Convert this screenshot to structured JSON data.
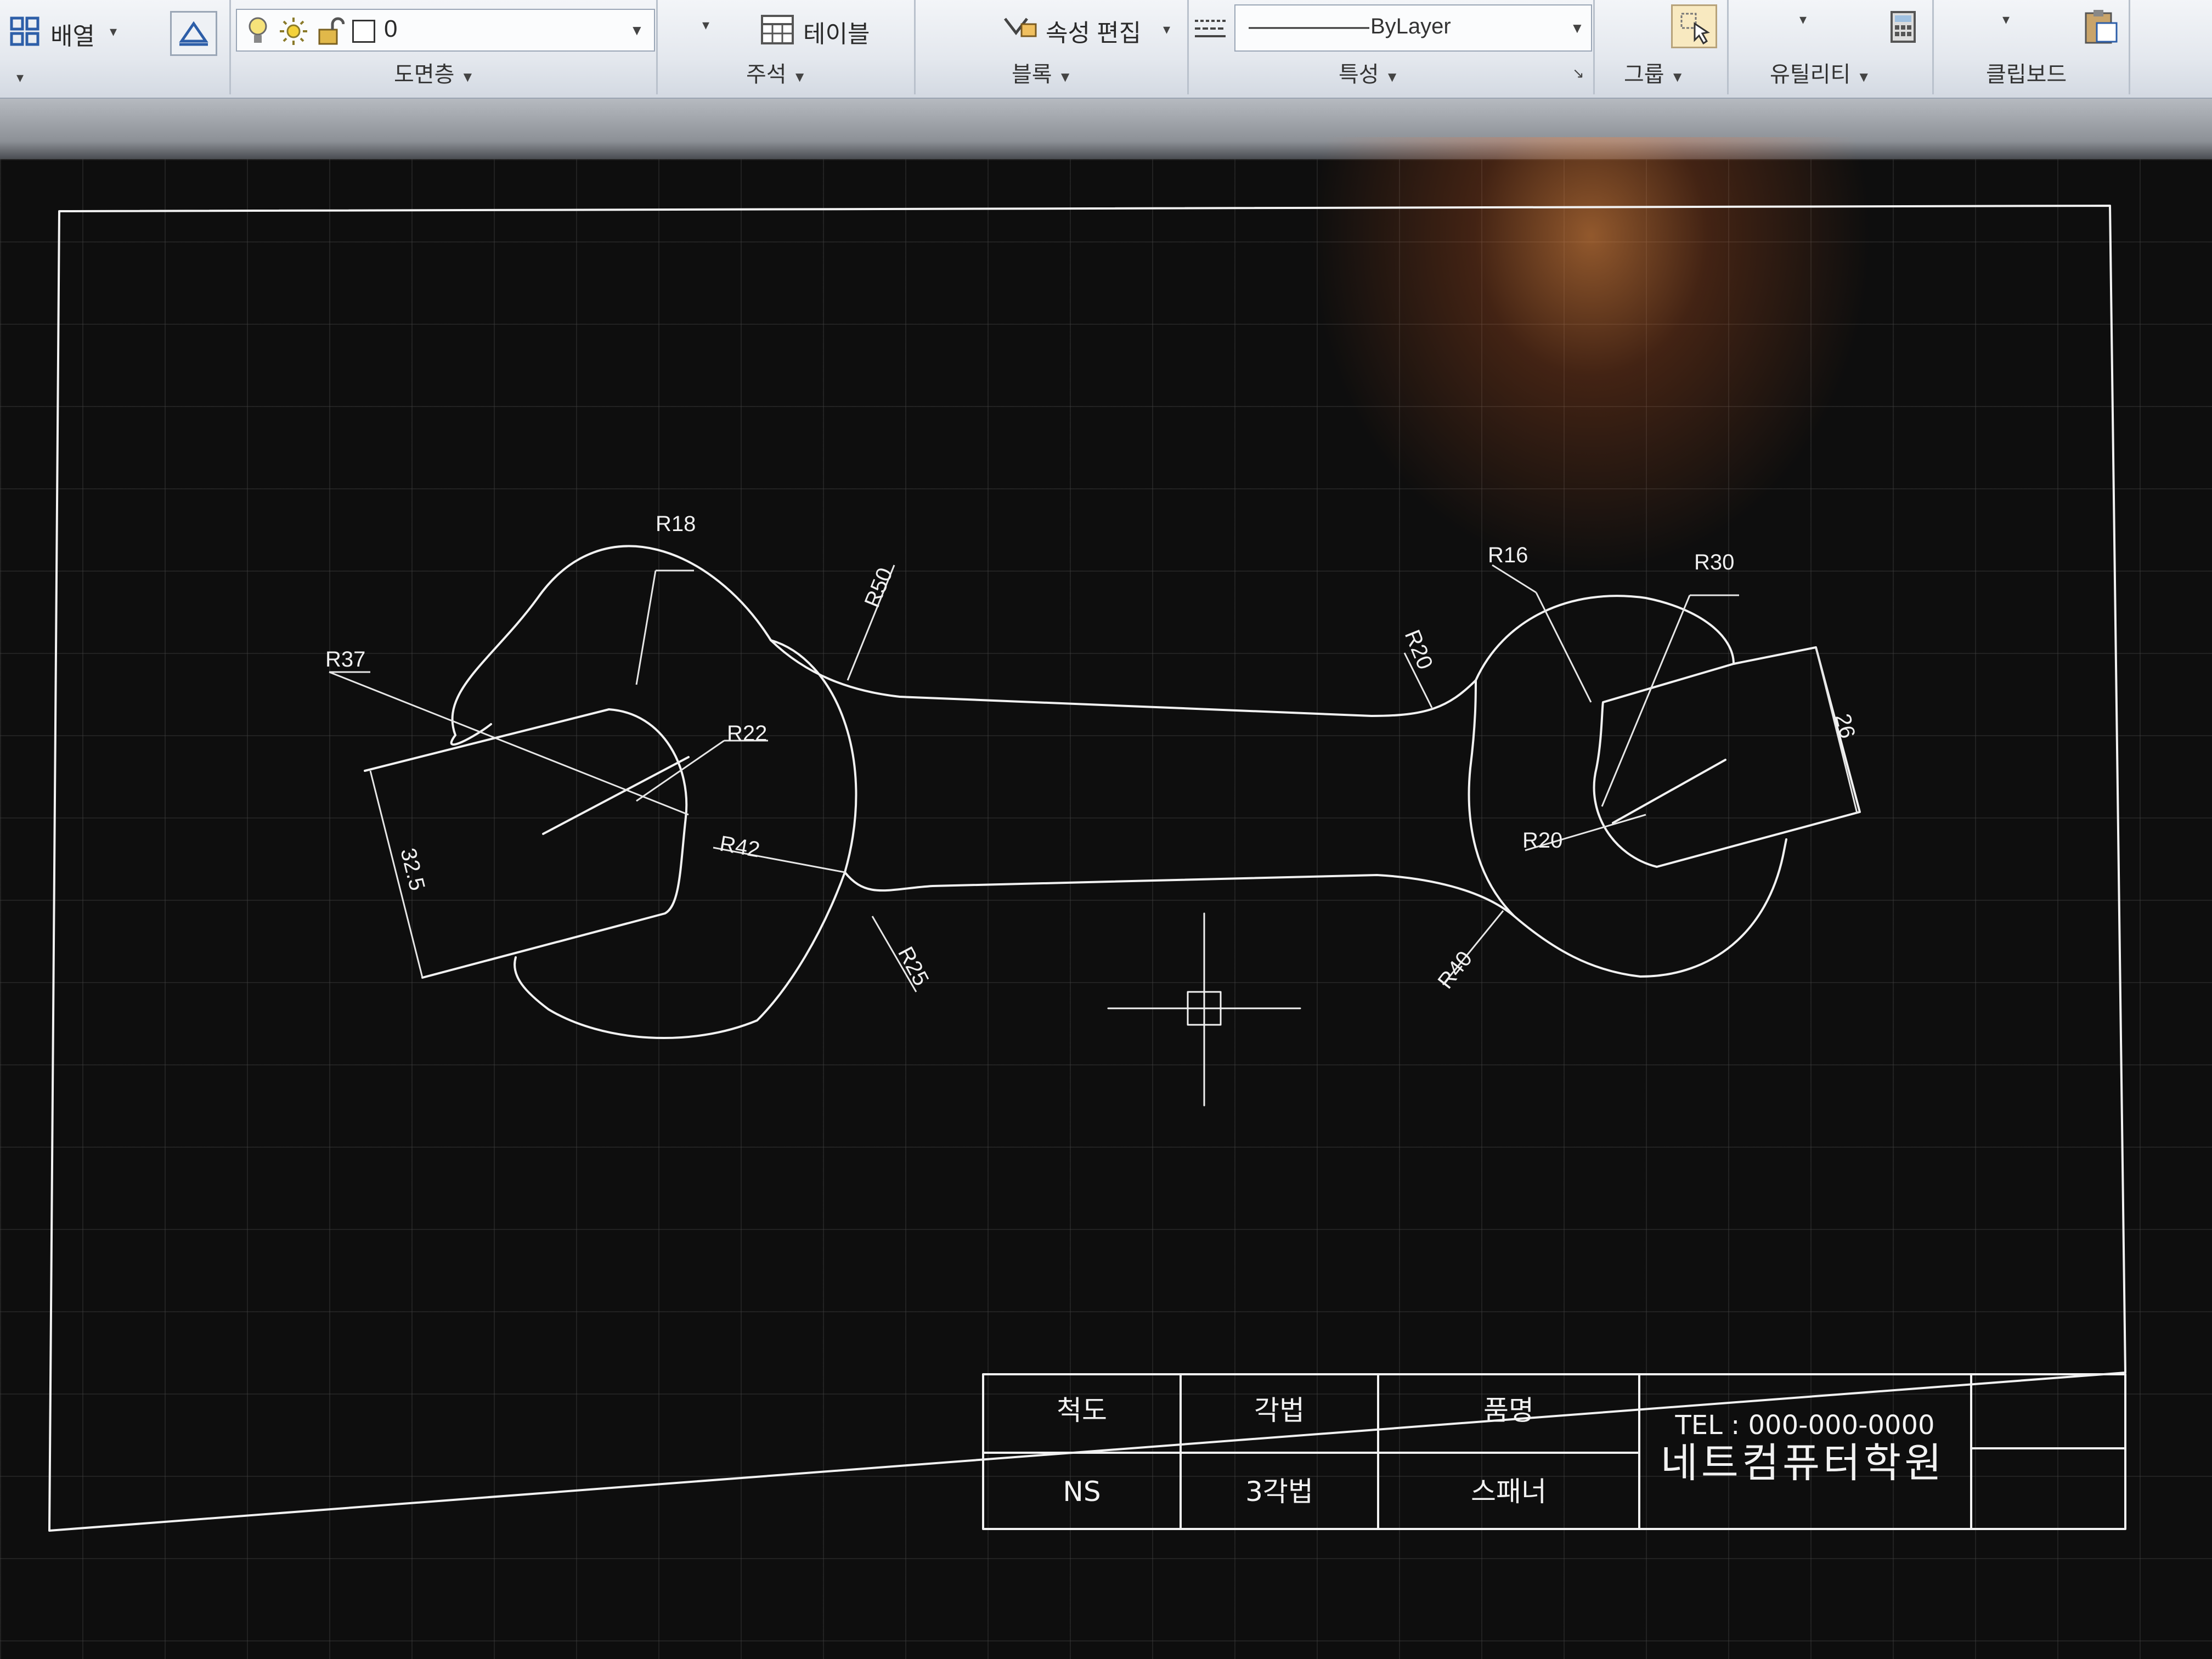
{
  "ribbon": {
    "array_label": "배열",
    "layer_value": "0",
    "table_label": "테이블",
    "attr_edit_label": "속성 편집",
    "linetype_value": "ByLayer",
    "panels": {
      "layers": "도면층",
      "annotation": "주석",
      "block": "블록",
      "properties": "특성",
      "groups": "그룹",
      "utilities": "유틸리티",
      "clipboard": "클립보드"
    }
  },
  "drawing": {
    "dimensions": {
      "r18": "R18",
      "r37": "R37",
      "r22": "R22",
      "r50": "R50",
      "r42": "R42",
      "r25": "R25",
      "d325": "32.5",
      "r16": "R16",
      "r30": "R30",
      "r20_top": "R20",
      "r20_inner": "R20",
      "r40": "R40",
      "d26": "26"
    },
    "title_block": {
      "scale_label": "척도",
      "projection_label": "각법",
      "part_name_label": "품명",
      "scale_value": "NS",
      "projection_value": "3각법",
      "part_name_value": "스패너",
      "tel": "TEL : 000-000-0000",
      "company": "네트컴퓨터학원"
    }
  },
  "colors": {
    "canvas_bg": "#0e0e0e",
    "line": "#f2f2f2",
    "ribbon_bg": "#e4e8ee"
  }
}
